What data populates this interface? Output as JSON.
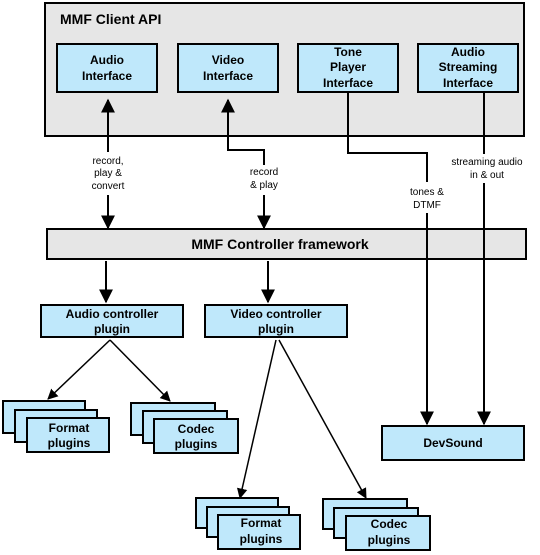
{
  "diagram": {
    "client_api": {
      "title": "MMF Client API",
      "interfaces": [
        {
          "lines": [
            "Audio",
            "Interface"
          ]
        },
        {
          "lines": [
            "Video",
            "Interface"
          ]
        },
        {
          "lines": [
            "Tone",
            "Player",
            "Interface"
          ]
        },
        {
          "lines": [
            "Audio",
            "Streaming",
            "Interface"
          ]
        }
      ]
    },
    "edge_labels": {
      "audio": [
        "record,",
        "play &",
        "convert"
      ],
      "video": [
        "record",
        "& play"
      ],
      "tone": [
        "tones &",
        "DTMF"
      ],
      "streaming": [
        "streaming audio",
        "in & out"
      ]
    },
    "controller_framework": "MMF Controller framework",
    "audio_controller": [
      "Audio controller",
      "plugin"
    ],
    "video_controller": [
      "Video controller",
      "plugin"
    ],
    "audio_format_plugins": [
      "Format",
      "plugins"
    ],
    "audio_codec_plugins": [
      "Codec",
      "plugins"
    ],
    "video_format_plugins": [
      "Format",
      "plugins"
    ],
    "video_codec_plugins": [
      "Codec",
      "plugins"
    ],
    "devsound": "DevSound",
    "colors": {
      "component_fill": "#bfe8fb",
      "container_fill": "#e6e6e6",
      "stroke": "#000000"
    }
  }
}
